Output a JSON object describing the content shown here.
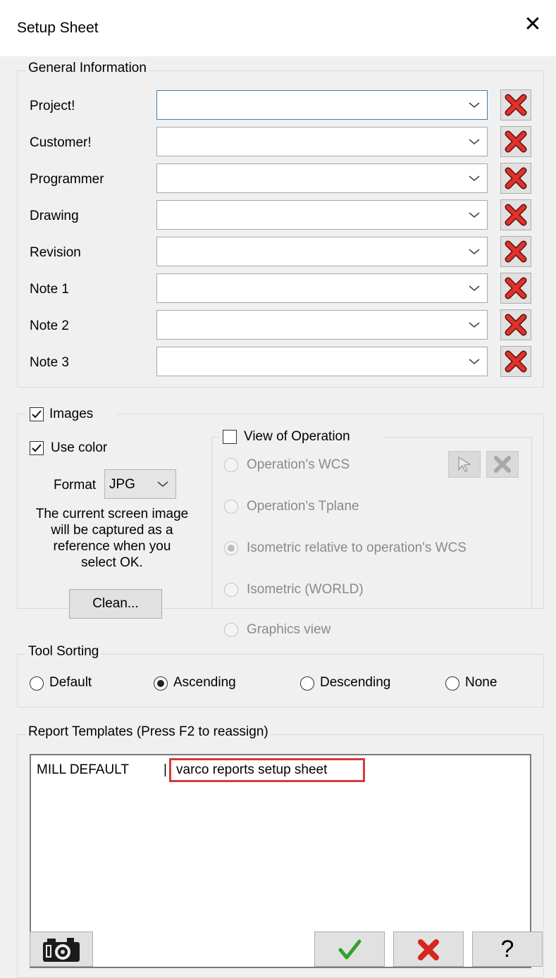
{
  "window": {
    "title": "Setup Sheet",
    "close_glyph": "✕"
  },
  "general": {
    "legend": "General Information",
    "fields": [
      {
        "label": "Project!",
        "value": ""
      },
      {
        "label": "Customer!",
        "value": ""
      },
      {
        "label": "Programmer",
        "value": ""
      },
      {
        "label": "Drawing",
        "value": ""
      },
      {
        "label": "Revision",
        "value": ""
      },
      {
        "label": "Note 1",
        "value": ""
      },
      {
        "label": "Note 2",
        "value": ""
      },
      {
        "label": "Note 3",
        "value": ""
      }
    ]
  },
  "images": {
    "label": "Images",
    "checked": true,
    "use_color_label": "Use color",
    "use_color_checked": true,
    "format_label": "Format",
    "format_value": "JPG",
    "info_line1": "The current screen image",
    "info_line2": "will be captured as a",
    "info_line3": "reference when you",
    "info_line4": "select OK.",
    "clean_label": "Clean...",
    "view": {
      "label": "View of Operation",
      "checked": false,
      "options": [
        "Operation's WCS",
        "Operation's Tplane",
        "Isometric relative to operation's WCS",
        "Isometric (WORLD)",
        "Graphics view"
      ],
      "selected_index": 2
    }
  },
  "sorting": {
    "legend": "Tool Sorting",
    "options": [
      "Default",
      "Ascending",
      "Descending",
      "None"
    ],
    "selected_index": 1
  },
  "templates": {
    "legend": "Report Templates (Press F2 to reassign)",
    "row_key": "MILL DEFAULT",
    "row_sep": "|",
    "row_value": "varco reports setup sheet",
    "highlight_color": "#d9383a"
  },
  "footer": {
    "ok_icon": "checkmark-icon",
    "cancel_icon": "red-x-icon",
    "help_glyph": "?"
  }
}
